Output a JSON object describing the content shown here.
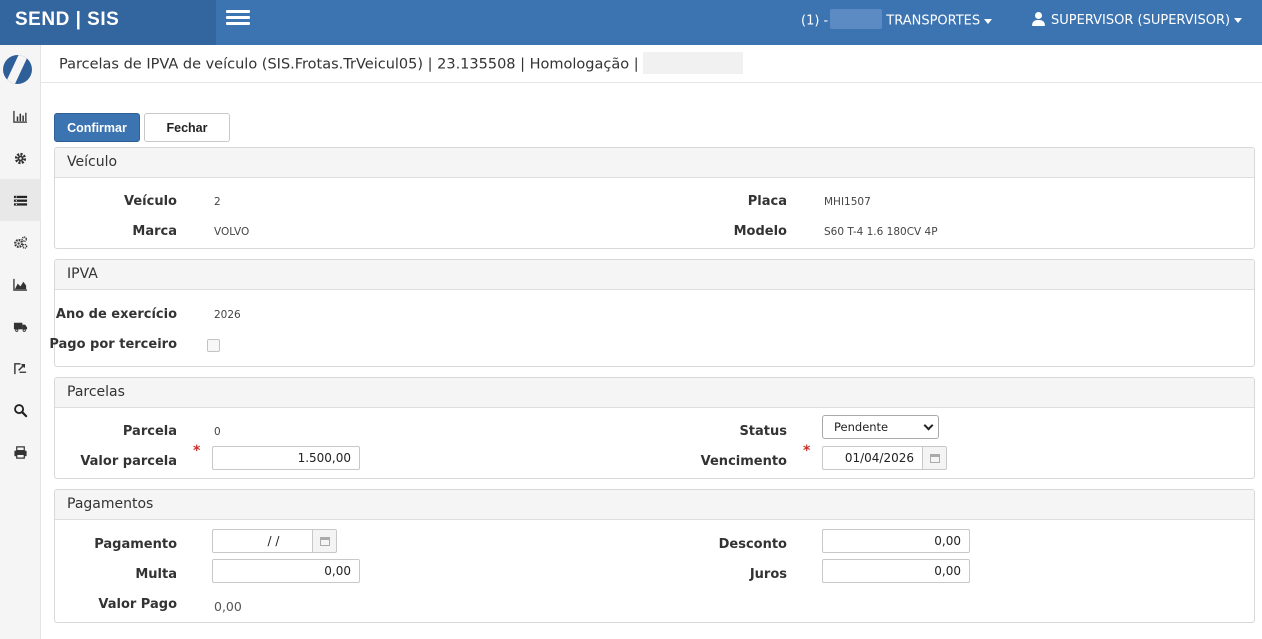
{
  "app": {
    "brand": "SEND | SIS",
    "company_prefix": "(1) -",
    "company_name": "TRANSPORTES",
    "user": "SUPERVISOR (SUPERVISOR)"
  },
  "sidebar": {
    "items": [
      {
        "icon": "bar-chart-icon"
      },
      {
        "icon": "gear-icon"
      },
      {
        "icon": "list-icon"
      },
      {
        "icon": "gears-icon"
      },
      {
        "icon": "area-chart-icon"
      },
      {
        "icon": "truck-icon"
      },
      {
        "icon": "export-icon"
      },
      {
        "icon": "search-icon"
      },
      {
        "icon": "print-icon"
      }
    ]
  },
  "page": {
    "title": "Parcelas de IPVA de veículo (SIS.Frotas.TrVeicul05) | 23.135508 | Homologação |"
  },
  "toolbar": {
    "confirm_label": "Confirmar",
    "close_label": "Fechar"
  },
  "veiculo": {
    "header": "Veículo",
    "veiculo_label": "Veículo",
    "veiculo_value": "2",
    "placa_label": "Placa",
    "placa_value": "MHI1507",
    "marca_label": "Marca",
    "marca_value": "VOLVO",
    "modelo_label": "Modelo",
    "modelo_value": "S60 T-4 1.6 180CV 4P"
  },
  "ipva": {
    "header": "IPVA",
    "ano_label": "Ano de exercício",
    "ano_value": "2026",
    "pago_label": "Pago por terceiro"
  },
  "parcelas": {
    "header": "Parcelas",
    "parcela_label": "Parcela",
    "parcela_value": "0",
    "status_label": "Status",
    "status_value": "Pendente",
    "valor_label": "Valor parcela",
    "valor_value": "1.500,00",
    "vencimento_label": "Vencimento",
    "vencimento_value": "01/04/2026"
  },
  "pagamentos": {
    "header": "Pagamentos",
    "pagamento_label": "Pagamento",
    "pagamento_value": "/ /",
    "desconto_label": "Desconto",
    "desconto_value": "0,00",
    "multa_label": "Multa",
    "multa_value": "0,00",
    "juros_label": "Juros",
    "juros_value": "0,00",
    "valor_pago_label": "Valor Pago",
    "valor_pago_value": "0,00"
  }
}
